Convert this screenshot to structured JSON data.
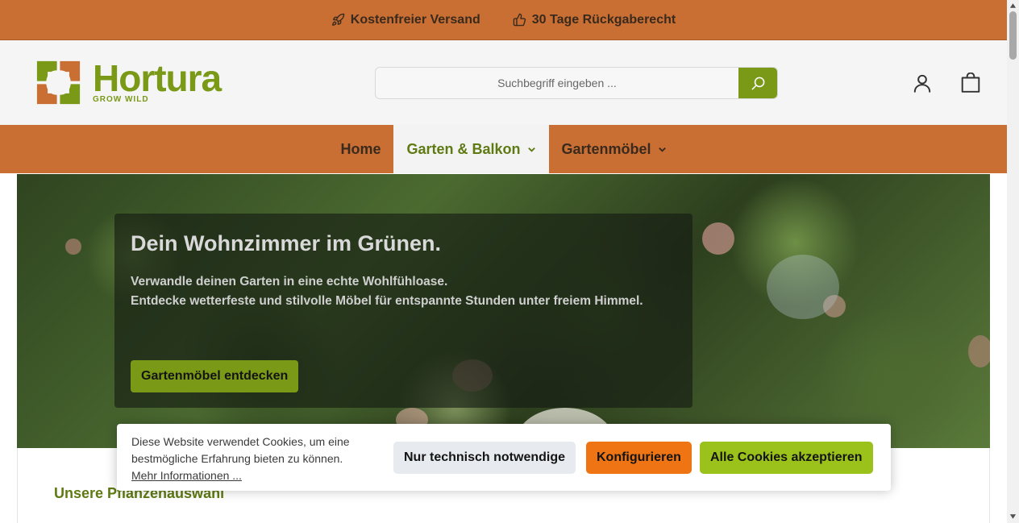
{
  "promo": {
    "shipping": "Kostenfreier Versand",
    "returns": "30 Tage Rückgaberecht"
  },
  "logo": {
    "name": "Hortura",
    "tagline": "GROW WILD"
  },
  "search": {
    "placeholder": "Suchbegriff eingeben ..."
  },
  "nav": {
    "items": [
      {
        "label": "Home",
        "active": false,
        "dropdown": false
      },
      {
        "label": "Garten & Balkon",
        "active": true,
        "dropdown": true
      },
      {
        "label": "Gartenmöbel",
        "active": false,
        "dropdown": true
      }
    ]
  },
  "hero": {
    "title": "Dein Wohnzimmer im Grünen.",
    "line1": "Verwandle deinen Garten in eine echte Wohlfühloase.",
    "line2": "Entdecke wetterfeste und stilvolle Möbel für entspannte Stunden unter freiem Himmel.",
    "button": "Gartenmöbel entdecken"
  },
  "section": {
    "title": "Unsere Pflanzenauswahl"
  },
  "cookie": {
    "text": "Diese Website verwendet Cookies, um eine bestmögliche Erfahrung bieten zu können.",
    "link": "Mehr Informationen ...",
    "btn_technical": "Nur technisch notwendige",
    "btn_configure": "Konfigurieren",
    "btn_accept_all": "Alle Cookies akzeptieren"
  },
  "colors": {
    "orange": "#c96f33",
    "brand_green": "#7a9a17",
    "configure_orange": "#ee7414",
    "accept_green": "#9bc21a"
  },
  "icons": [
    "rocket-icon",
    "thumbs-up-icon",
    "search-icon",
    "user-icon",
    "shopping-bag-icon",
    "chevron-down-icon"
  ]
}
